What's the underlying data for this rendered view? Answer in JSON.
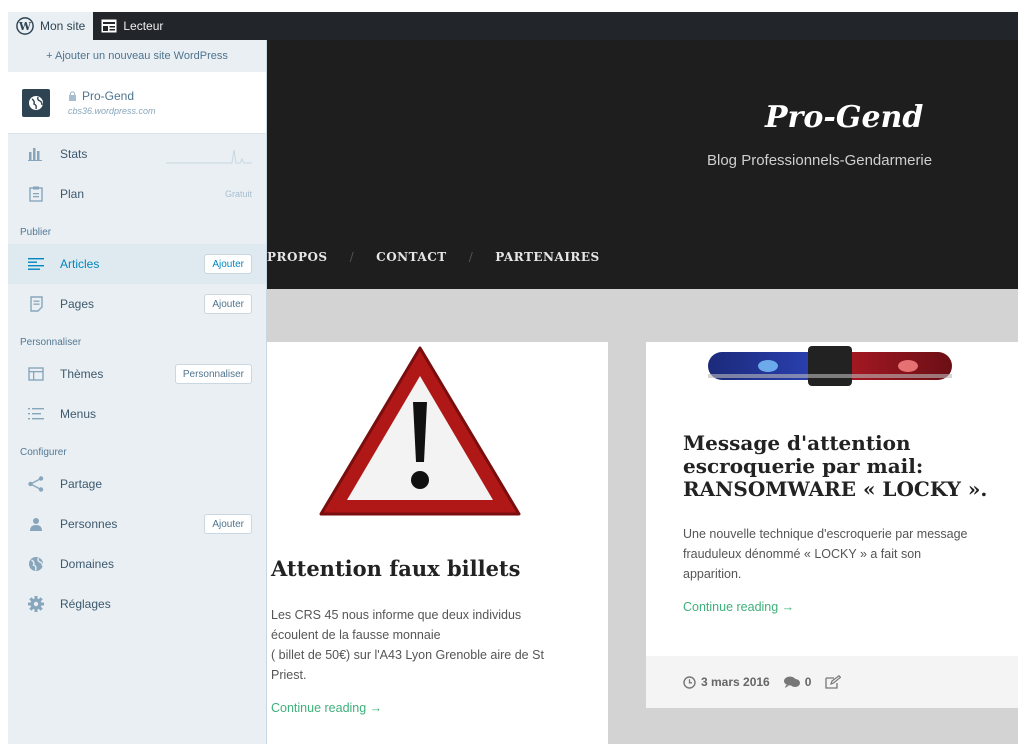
{
  "adminbar": {
    "my_site": "Mon site",
    "reader": "Lecteur"
  },
  "sidebar": {
    "add_site": "+ Ajouter un nouveau site WordPress",
    "site": {
      "name": "Pro-Gend",
      "url": "cbs36.wordpress.com"
    },
    "items_top": [
      {
        "label": "Stats",
        "icon": "stats-icon"
      },
      {
        "label": "Plan",
        "meta": "Gratuit",
        "icon": "plan-icon"
      }
    ],
    "sections": [
      {
        "label": "Publier",
        "items": [
          {
            "label": "Articles",
            "button": "Ajouter",
            "icon": "articles-icon",
            "selected": true
          },
          {
            "label": "Pages",
            "button": "Ajouter",
            "icon": "pages-icon"
          }
        ]
      },
      {
        "label": "Personnaliser",
        "items": [
          {
            "label": "Thèmes",
            "button": "Personnaliser",
            "icon": "themes-icon"
          },
          {
            "label": "Menus",
            "icon": "menus-icon"
          }
        ]
      },
      {
        "label": "Configurer",
        "items": [
          {
            "label": "Partage",
            "icon": "share-icon"
          },
          {
            "label": "Personnes",
            "button": "Ajouter",
            "icon": "people-icon"
          },
          {
            "label": "Domaines",
            "icon": "globe-icon"
          },
          {
            "label": "Réglages",
            "icon": "gear-icon"
          }
        ]
      }
    ]
  },
  "site": {
    "title": "Pro-Gend",
    "tagline": "Blog Professionnels-Gendarmerie",
    "nav": [
      "PROPOS",
      "CONTACT",
      "PARTENAIRES"
    ]
  },
  "posts": [
    {
      "title": "Attention faux billets",
      "excerpt": [
        "Les CRS 45 nous informe que deux individus",
        "écoulent de la fausse monnaie",
        "( billet de 50€) sur l'A43 Lyon Grenoble aire de St",
        "Priest."
      ],
      "read_more": "Continue reading →"
    },
    {
      "title": [
        "Message d'attention",
        "escroquerie par mail:",
        "RANSOMWARE « LOCKY »."
      ],
      "excerpt": [
        "Une nouvelle technique d'escroquerie par message",
        "frauduleux dénommé « LOCKY » a fait son",
        "apparition."
      ],
      "read_more": "Continue reading →",
      "date": "3 mars 2016",
      "comments": "0"
    }
  ],
  "colors": {
    "accent": "#0087be",
    "link": "#40b07b",
    "header_bg": "#1e1e1e",
    "adminbar_bg": "#22262a"
  }
}
